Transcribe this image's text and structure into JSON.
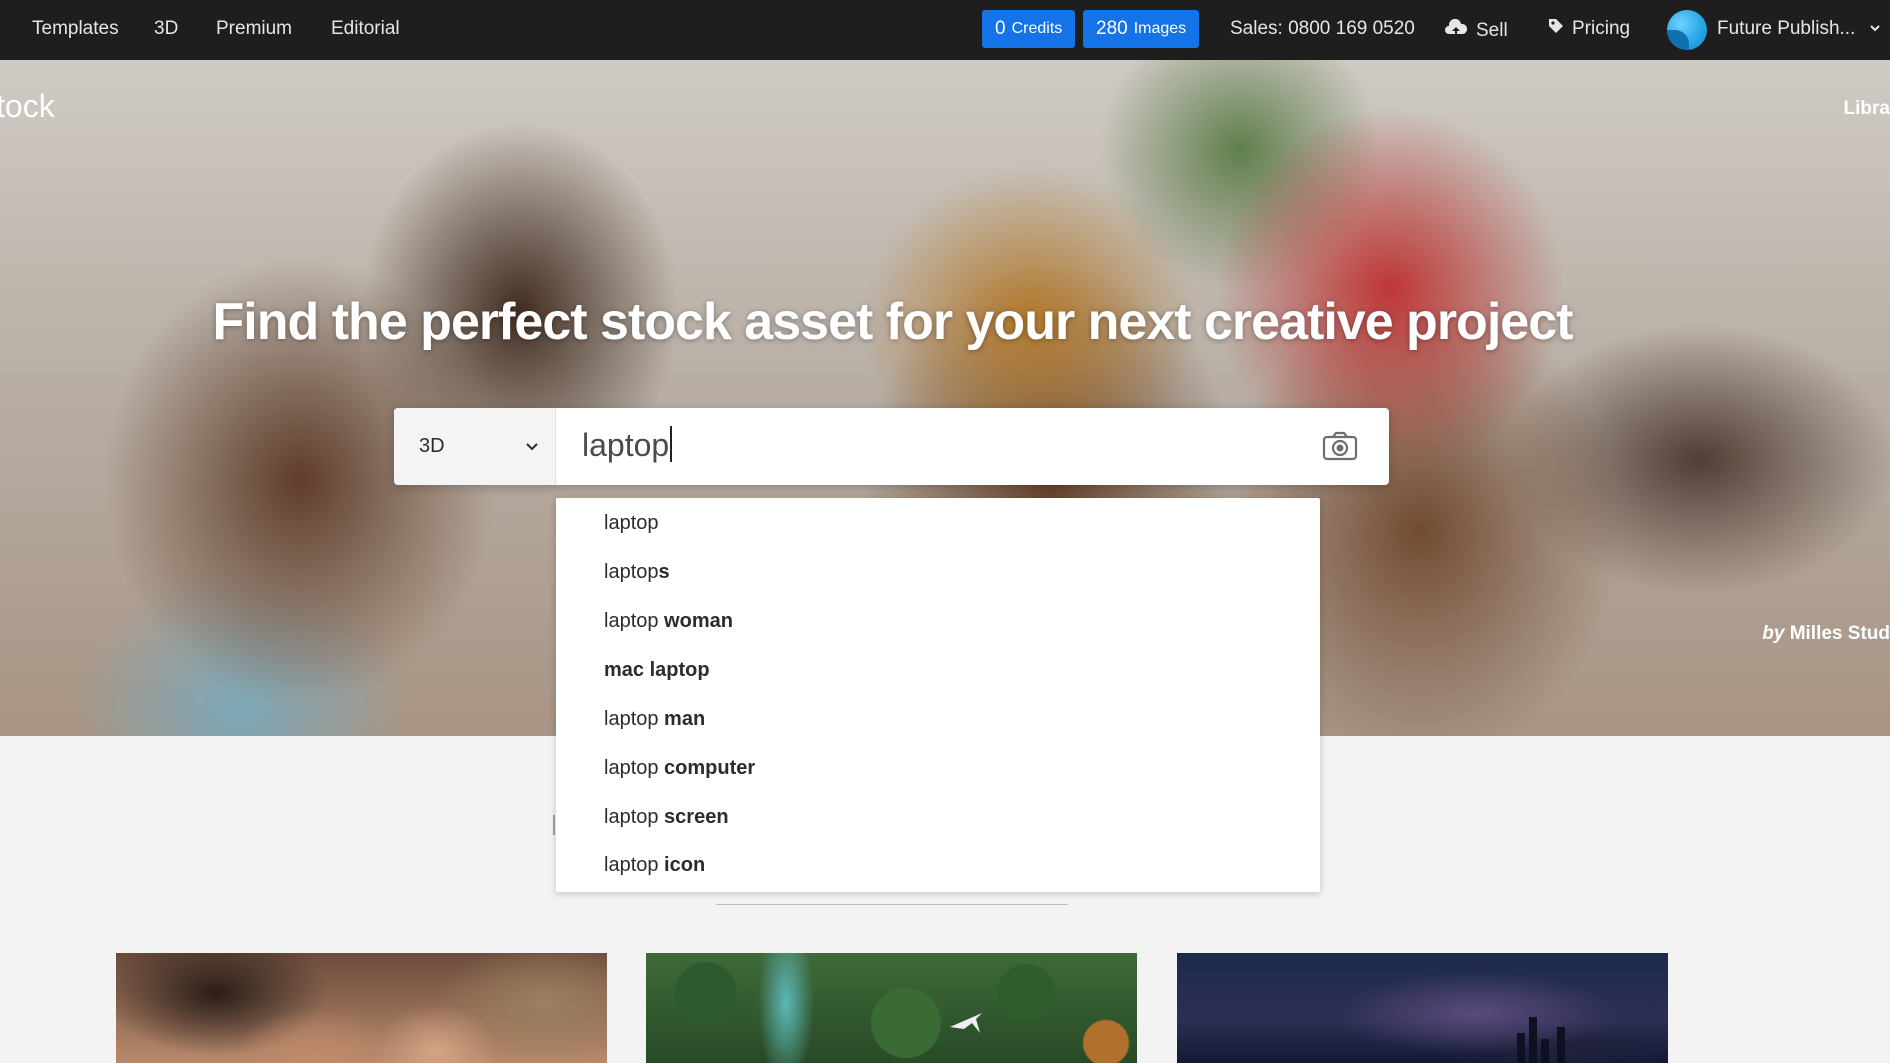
{
  "topbar": {
    "nav": [
      "Templates",
      "3D",
      "Premium",
      "Editorial"
    ],
    "credits": {
      "value": "0",
      "label": "Credits"
    },
    "images": {
      "value": "280",
      "label": "Images"
    },
    "sales": "Sales: 0800 169 0520",
    "sell": "Sell",
    "pricing": "Pricing",
    "account": "Future Publish..."
  },
  "hero": {
    "brand": "tock",
    "libraries": "Libra",
    "headline": "Find the perfect stock asset for your next creative project",
    "credit_by": "by",
    "credit_name": "Milles Stud"
  },
  "search": {
    "type": "3D",
    "query": "laptop"
  },
  "suggestions": [
    {
      "prefix": "laptop",
      "suffix": ""
    },
    {
      "prefix": "laptop",
      "suffix": "s"
    },
    {
      "prefix": "laptop",
      "suffix": " woman"
    },
    {
      "prefix": "",
      "suffix": "mac laptop"
    },
    {
      "prefix": "laptop",
      "suffix": " man"
    },
    {
      "prefix": "laptop",
      "suffix": " computer"
    },
    {
      "prefix": "laptop",
      "suffix": " screen"
    },
    {
      "prefix": "laptop",
      "suffix": " icon"
    }
  ],
  "colors": {
    "topbar": "#1e1e1e",
    "accent": "#1473e6",
    "background": "#f3f3f3"
  },
  "icons": [
    "chevron-down-icon",
    "camera-icon",
    "cloud-upload-icon",
    "tag-icon"
  ]
}
